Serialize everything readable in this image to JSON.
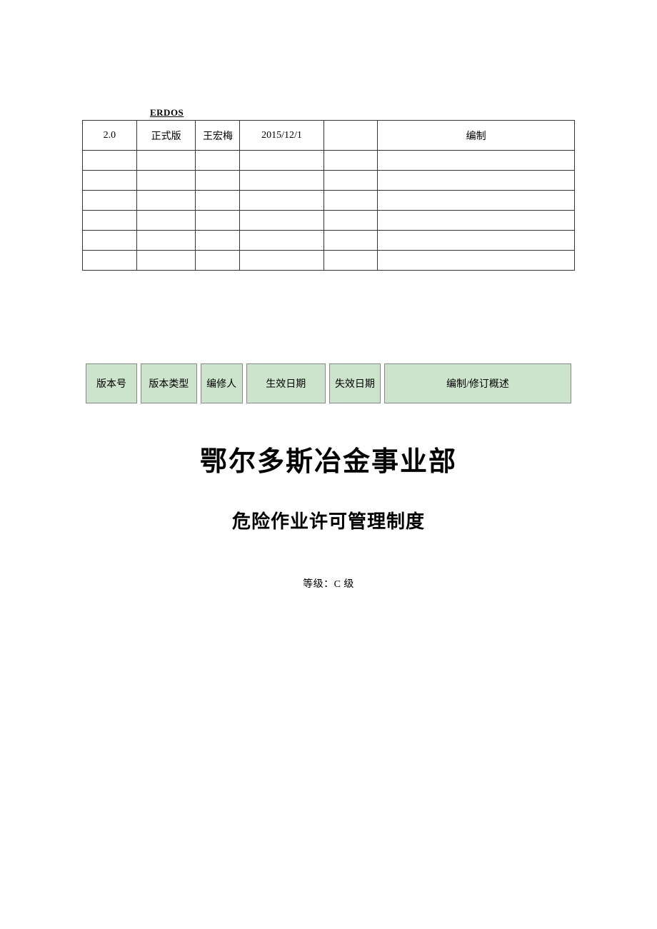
{
  "brand": "ERDOS",
  "topTable": {
    "rows": [
      {
        "c1": "2.0",
        "c2": "正式版",
        "c3": "王宏梅",
        "c4": "2015/12/1",
        "c5": "",
        "c6": "编制"
      },
      {
        "c1": "",
        "c2": "",
        "c3": "",
        "c4": "",
        "c5": "",
        "c6": ""
      },
      {
        "c1": "",
        "c2": "",
        "c3": "",
        "c4": "",
        "c5": "",
        "c6": ""
      },
      {
        "c1": "",
        "c2": "",
        "c3": "",
        "c4": "",
        "c5": "",
        "c6": ""
      },
      {
        "c1": "",
        "c2": "",
        "c3": "",
        "c4": "",
        "c5": "",
        "c6": ""
      },
      {
        "c1": "",
        "c2": "",
        "c3": "",
        "c4": "",
        "c5": "",
        "c6": ""
      },
      {
        "c1": "",
        "c2": "",
        "c3": "",
        "c4": "",
        "c5": "",
        "c6": ""
      }
    ]
  },
  "greenHeader": {
    "c1": "版本号",
    "c2": "版本类型",
    "c3": "编修人",
    "c4": "生效日期",
    "c5": "失效日期",
    "c6": "编制/修订概述"
  },
  "titles": {
    "main": "鄂尔多斯冶金事业部",
    "sub": "危险作业许可管理制度",
    "grade": "等级：C 级"
  }
}
